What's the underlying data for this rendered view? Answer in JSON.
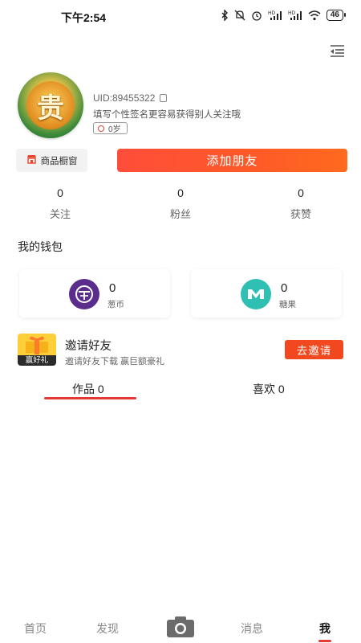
{
  "status_bar": {
    "time": "下午2:54",
    "battery": "46",
    "icons": [
      "bluetooth-icon",
      "mute-icon",
      "alarm-icon",
      "hd-signal-icon",
      "hd-signal-icon",
      "wifi-icon",
      "battery-icon"
    ]
  },
  "profile": {
    "avatar_glyph": "贵",
    "uid": "UID:89455322",
    "signature": "填写个性签名更容易获得别人关注哦",
    "age": "0岁"
  },
  "actions": {
    "shop_label": "商品橱窗",
    "add_friend_label": "添加朋友"
  },
  "stats": [
    {
      "value": "0",
      "label": "关注"
    },
    {
      "value": "0",
      "label": "粉丝"
    },
    {
      "value": "0",
      "label": "获赞"
    }
  ],
  "wallet": {
    "title": "我的钱包",
    "items": [
      {
        "value": "0",
        "label": "葱币",
        "color": "#5a2d8c"
      },
      {
        "value": "0",
        "label": "糖果",
        "color": "#2fbfb3"
      }
    ]
  },
  "invite": {
    "badge_text": "赢好礼",
    "title": "邀请好友",
    "subtitle": "邀请好友下载 赢巨额豪礼",
    "button": "去邀请"
  },
  "tabs": [
    {
      "label": "作品 0",
      "active": true
    },
    {
      "label": "喜欢 0",
      "active": false
    }
  ],
  "bottom_nav": [
    {
      "label": "首页"
    },
    {
      "label": "发现"
    },
    {
      "label": "消息"
    },
    {
      "label": "我",
      "active": true
    }
  ],
  "colors": {
    "accent": "#e53935",
    "add_friend_gradient_start": "#ff4d3a",
    "add_friend_gradient_end": "#ff6a1e",
    "invite_button": "#f2481f"
  }
}
